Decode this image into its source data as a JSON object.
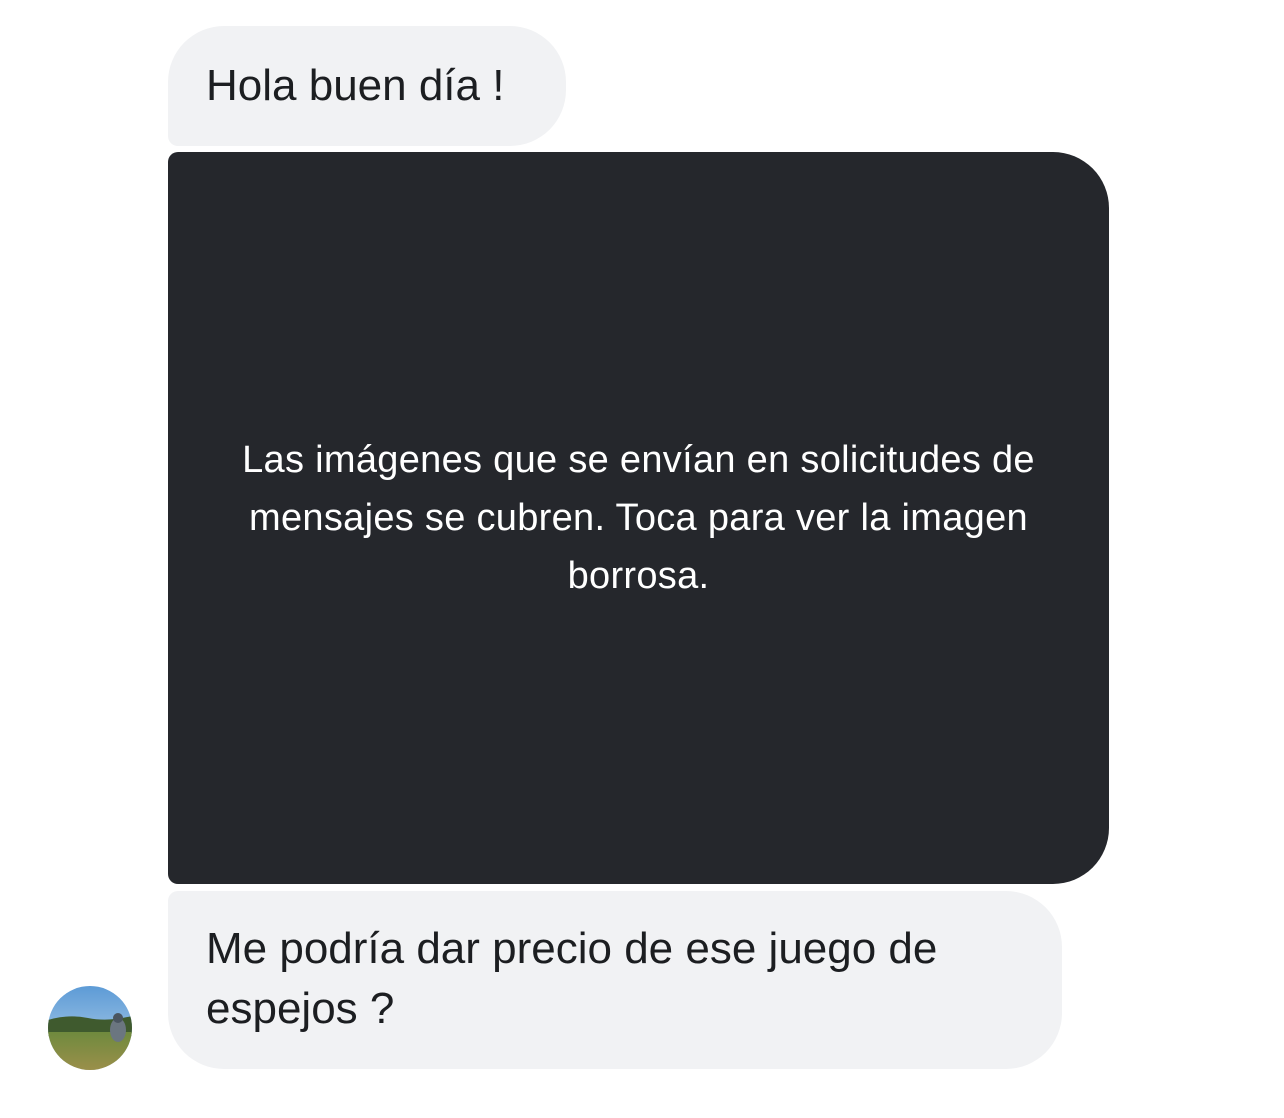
{
  "conversation": {
    "messages": [
      {
        "id": "msg-1",
        "type": "text",
        "text": "Hola buen día !"
      },
      {
        "id": "msg-2",
        "type": "covered-image",
        "cover_text": "Las imágenes que se envían en solicitudes de mensajes se cubren. Toca para ver la imagen borrosa."
      },
      {
        "id": "msg-3",
        "type": "text",
        "text": "Me podría dar precio de ese juego de espejos ?"
      }
    ],
    "sender_avatar": {
      "icon": "profile-photo-landscape"
    }
  },
  "colors": {
    "incoming_bubble": "#f1f2f4",
    "covered_image_bg": "#25272c",
    "text": "#1c1e21"
  }
}
